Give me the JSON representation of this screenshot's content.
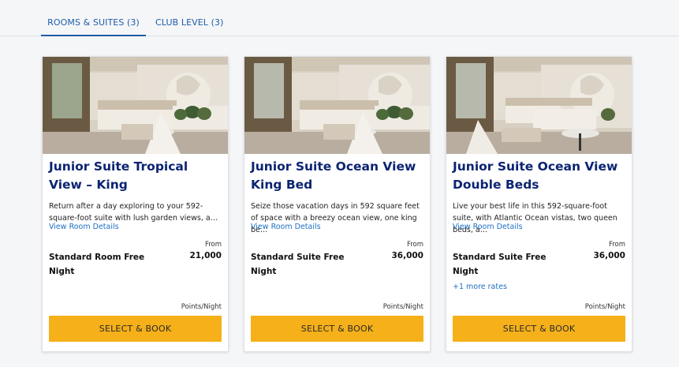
{
  "tabs": [
    {
      "label": "ROOMS & SUITES (3)",
      "active": true
    },
    {
      "label": "CLUB LEVEL (3)",
      "active": false
    }
  ],
  "colors": {
    "accent": "#1e5da8",
    "title": "#0b2472",
    "button": "#f5b01a",
    "link": "#1e6fc4"
  },
  "rooms": [
    {
      "image_icon": "room-photo",
      "title": "Junior Suite Tropical View – King",
      "description": "Return after a day exploring to your 592-square-foot suite with lush garden views, a…",
      "details_link": "View Room Details",
      "from_label": "From",
      "points": "21,000",
      "rate_name": "Standard Room Free Night",
      "more_rates": "",
      "points_unit": "Points/Night",
      "button": "SELECT & BOOK"
    },
    {
      "image_icon": "room-photo",
      "title": "Junior Suite Ocean View King Bed",
      "description": "Seize those vacation days in 592 square feet of space with a breezy ocean view, one king be…",
      "details_link": "View Room Details",
      "from_label": "From",
      "points": "36,000",
      "rate_name": "Standard Suite Free Night",
      "more_rates": "",
      "points_unit": "Points/Night",
      "button": "SELECT & BOOK"
    },
    {
      "image_icon": "room-photo",
      "title": "Junior Suite Ocean View Double Beds",
      "description": "Live your best life in this 592-square-foot suite, with Atlantic Ocean vistas, two queen beds, a…",
      "details_link": "View Room Details",
      "from_label": "From",
      "points": "36,000",
      "rate_name": "Standard Suite Free Night",
      "more_rates": "+1 more rates",
      "points_unit": "Points/Night",
      "button": "SELECT & BOOK"
    }
  ]
}
